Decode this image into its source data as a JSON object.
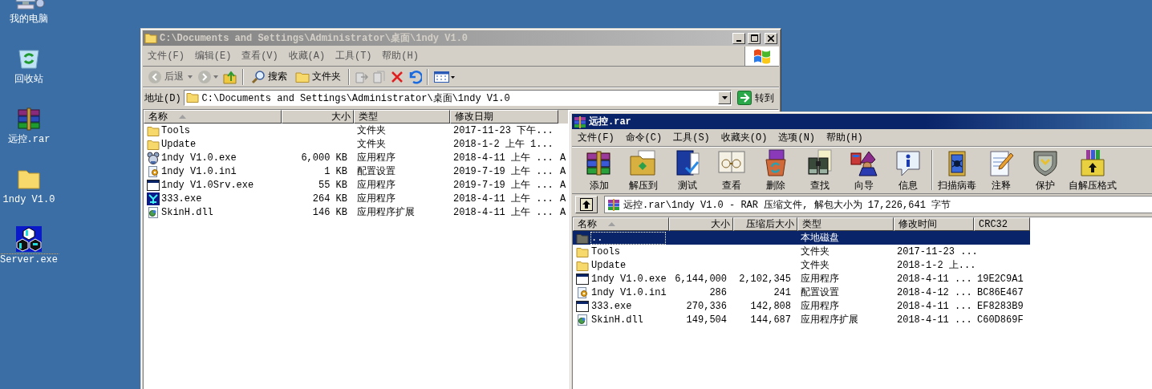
{
  "desktop": {
    "icons": [
      {
        "label": "我的电脑",
        "kind": "computer",
        "selected": false
      },
      {
        "label": "回收站",
        "kind": "recycle",
        "selected": false
      },
      {
        "label": "远控.rar",
        "kind": "rar",
        "selected": false
      },
      {
        "label": "1ndy V1.0",
        "kind": "folder",
        "selected": false
      },
      {
        "label": "Server.exe",
        "kind": "cubes",
        "selected": true
      }
    ]
  },
  "explorer": {
    "title": "C:\\Documents and Settings\\Administrator\\桌面\\1ndy V1.0",
    "active": false,
    "menu": [
      "文件(F)",
      "编辑(E)",
      "查看(V)",
      "收藏(A)",
      "工具(T)",
      "帮助(H)"
    ],
    "toolbar": {
      "back": "后退",
      "search": "搜索",
      "folders": "文件夹"
    },
    "address": {
      "label": "地址(D)",
      "value": "C:\\Documents and Settings\\Administrator\\桌面\\1ndy V1.0",
      "go": "转到"
    },
    "columns": [
      "名称",
      "大小",
      "类型",
      "修改日期"
    ],
    "rows": [
      {
        "kind": "folder",
        "name": "Tools",
        "type": "文件夹",
        "date": "2017-11-23 下午...",
        "selected": false
      },
      {
        "kind": "folder",
        "name": "Update",
        "type": "文件夹",
        "date": "2018-1-2 上午 1...",
        "selected": false
      },
      {
        "kind": "mascot",
        "name": "1ndy V1.0.exe",
        "size": "6,000 KB",
        "type": "应用程序",
        "date": "2018-4-11 上午 ...",
        "attr": "A",
        "selected": false
      },
      {
        "kind": "settings",
        "name": "1ndy V1.0.ini",
        "size": "1 KB",
        "type": "配置设置",
        "date": "2019-7-19 上午 ...",
        "attr": "A",
        "selected": false
      },
      {
        "kind": "window",
        "name": "1ndy V1.0Srv.exe",
        "size": "55 KB",
        "type": "应用程序",
        "date": "2019-7-19 上午 ...",
        "attr": "A",
        "selected": false
      },
      {
        "kind": "blueapp",
        "name": "333.exe",
        "size": "264 KB",
        "type": "应用程序",
        "date": "2018-4-11 上午 ...",
        "attr": "A",
        "selected": false
      },
      {
        "kind": "dll",
        "name": "SkinH.dll",
        "size": "146 KB",
        "type": "应用程序扩展",
        "date": "2018-4-11 上午 ...",
        "attr": "A",
        "selected": false
      }
    ]
  },
  "winrar": {
    "title": "远控.rar",
    "active": true,
    "menu": [
      "文件(F)",
      "命令(C)",
      "工具(S)",
      "收藏夹(O)",
      "选项(N)",
      "帮助(H)"
    ],
    "toolbar_groups": [
      [
        "添加",
        "解压到",
        "测试",
        "查看",
        "删除",
        "查找",
        "向导",
        "信息"
      ],
      [
        "扫描病毒",
        "注释",
        "保护",
        "自解压格式"
      ]
    ],
    "path": "远控.rar\\1ndy V1.0 - RAR 压缩文件, 解包大小为 17,226,641 字节",
    "columns": [
      "名称",
      "大小",
      "压缩后大小",
      "类型",
      "修改时间",
      "CRC32"
    ],
    "rows": [
      {
        "kind": "up",
        "name": "..",
        "type": "本地磁盘",
        "selected": true
      },
      {
        "kind": "folder",
        "name": "Tools",
        "type": "文件夹",
        "date": "2017-11-23 ...",
        "selected": false
      },
      {
        "kind": "folder",
        "name": "Update",
        "type": "文件夹",
        "date": "2018-1-2 上...",
        "selected": false
      },
      {
        "kind": "window",
        "name": "1ndy V1.0.exe",
        "size": "6,144,000",
        "packed": "2,102,345",
        "type": "应用程序",
        "date": "2018-4-11 ...",
        "crc": "19E2C9A1",
        "selected": false
      },
      {
        "kind": "settings",
        "name": "1ndy V1.0.ini",
        "size": "286",
        "packed": "241",
        "type": "配置设置",
        "date": "2018-4-12 ...",
        "crc": "BC86E467",
        "selected": false
      },
      {
        "kind": "window",
        "name": "333.exe",
        "size": "270,336",
        "packed": "142,808",
        "type": "应用程序",
        "date": "2018-4-11 ...",
        "crc": "EF8283B9",
        "selected": false
      },
      {
        "kind": "dll",
        "name": "SkinH.dll",
        "size": "149,504",
        "packed": "144,687",
        "type": "应用程序扩展",
        "date": "2018-4-11 ...",
        "crc": "C60D869F",
        "selected": false
      }
    ]
  }
}
